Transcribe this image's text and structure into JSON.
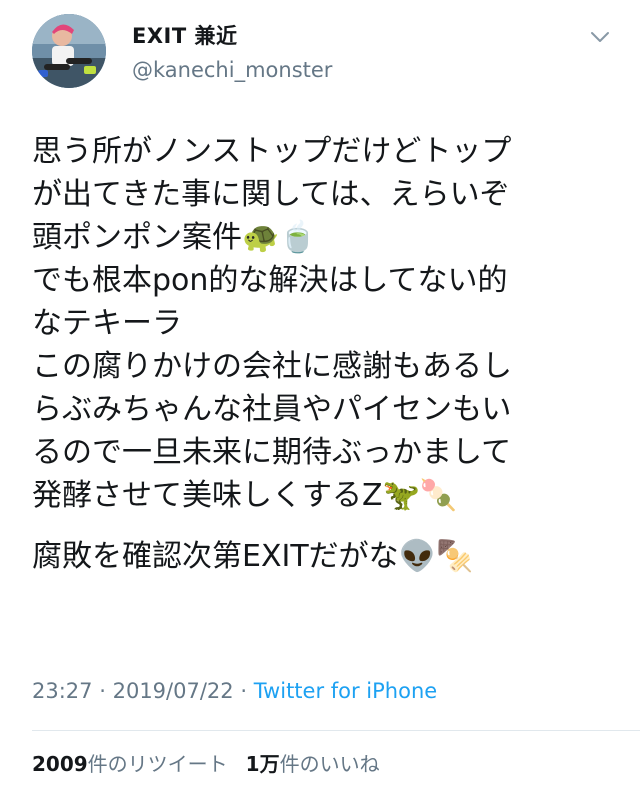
{
  "author": {
    "display_name": "EXIT 兼近",
    "handle": "@kanechi_monster"
  },
  "tweet": {
    "lines": [
      "思う所がノンストップだけどトップ",
      "が出てきた事に関しては、えらいぞ",
      "頭ポンポン案件🐢🍵",
      "でも根本pon的な解決はしてない的",
      "なテキーラ",
      "この腐りかけの会社に感謝もあるし",
      "らぶみちゃんな社員やパイセンもい",
      "るので一旦未来に期待ぶっかまして",
      "発酵させて美味しくするZ🦖🍡"
    ],
    "last_line": "腐敗を確認次第EXITだがな👽🍢"
  },
  "meta": {
    "time": "23:27",
    "date": "2019/07/22",
    "separator": "·",
    "source": "Twitter for iPhone"
  },
  "stats": {
    "retweet_count": "2009",
    "retweet_label": "件のリツイート",
    "like_count": "1万",
    "like_label": "件のいいね"
  },
  "colors": {
    "text": "#14171a",
    "secondary": "#657786",
    "link": "#1da1f2",
    "divider": "#e1e8ed"
  },
  "icons": {
    "menu": "chevron-down-icon"
  }
}
